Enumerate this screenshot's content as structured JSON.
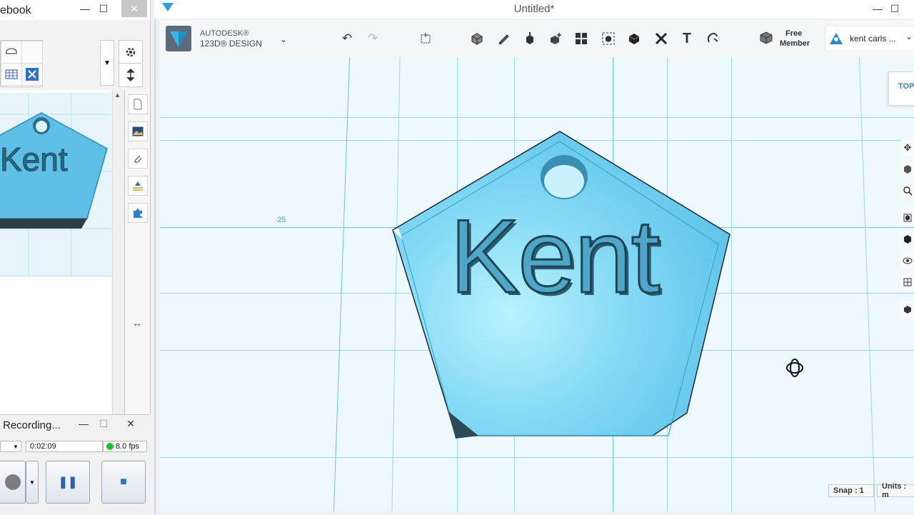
{
  "left_window": {
    "title": "ebook",
    "minimize": "—",
    "maximize": "☐",
    "close": "✕",
    "scroll_up": "▲",
    "settings_icon": "gear-icon",
    "dropdown": "▼",
    "thumbnail_text": "Kent",
    "resize_handle": "↔"
  },
  "recording_window": {
    "title": "Recording...",
    "minimize": "—",
    "maximize": "☐",
    "close": "✕",
    "elapsed": "0:02:09",
    "fps": "8.0 fps",
    "pause_label": "❚❚",
    "stop_label": "■"
  },
  "app": {
    "window_title": "Untitled*",
    "minimize": "—",
    "maximize": "☐",
    "brand_top": "AUTODESK®",
    "brand_bottom": "123D® DESIGN",
    "account_label_line1": "Free",
    "account_label_line2": "Member",
    "user_name": "kent carls ...",
    "undo": "↶",
    "redo": "↷",
    "text_tool": "T",
    "viewcube_label": "TOP",
    "grid_label": "25",
    "model_text": "Kent",
    "snap_label": "Snap : 1",
    "units_label": "Units : m"
  },
  "colors": {
    "model_fill": "#74d1f2",
    "model_edge": "#3aa8cc",
    "grid_line": "#9fd5e6",
    "viewport_bg": "#eef9fd",
    "accent": "#27aee0"
  }
}
